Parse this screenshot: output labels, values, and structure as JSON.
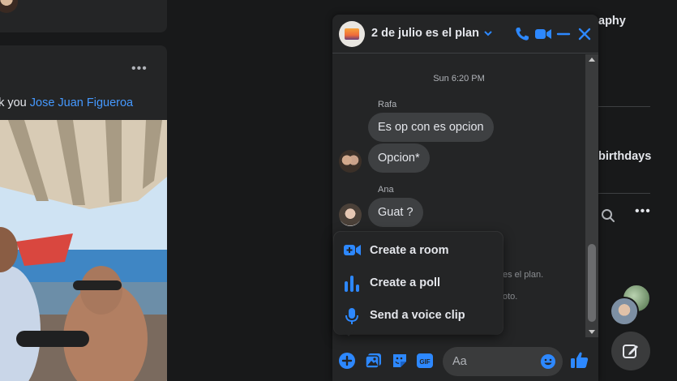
{
  "feed": {
    "post_text_prefix": "nk you",
    "post_text_link": "Jose Juan Figueroa",
    "more_label": "•••"
  },
  "right_column": {
    "item1_text": "aphy",
    "item2_text": "birthdays",
    "more_label": "•••"
  },
  "chat": {
    "title": "2 de julio es el plan",
    "timestamp": "Sun 6:20 PM",
    "messages": [
      {
        "sender": "Rafa",
        "text": "Es op con es opcion"
      },
      {
        "sender": "",
        "text": "Opcion*"
      },
      {
        "sender": "Ana",
        "text": "Guat ?"
      }
    ],
    "faded_line_1": "es el plan.",
    "faded_line_2": "oto."
  },
  "menu": {
    "items": [
      {
        "label": "Create a room",
        "icon": "video-camera-plus-icon"
      },
      {
        "label": "Create a poll",
        "icon": "poll-icon"
      },
      {
        "label": "Send a voice clip",
        "icon": "microphone-icon"
      }
    ]
  },
  "composer": {
    "placeholder": "Aa",
    "icons": [
      "plus-icon",
      "photo-icon",
      "sticker-icon",
      "gif-icon",
      "emoji-icon",
      "like-icon"
    ]
  },
  "colors": {
    "accent": "#2d88ff",
    "background": "#18191a",
    "surface": "#242526",
    "bubble": "#3e4042",
    "link": "#4599ff"
  }
}
